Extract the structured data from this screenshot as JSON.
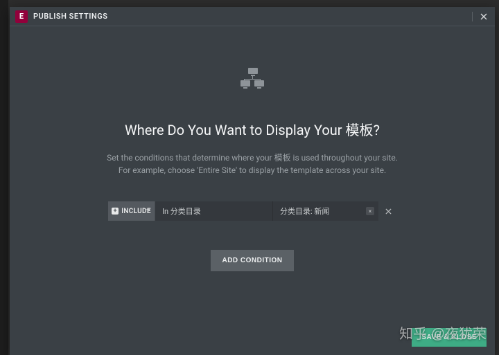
{
  "header": {
    "brand_glyph": "E",
    "title": "PUBLISH SETTINGS"
  },
  "hero": {
    "headline": "Where Do You Want to Display Your 模板?",
    "sub_line1": "Set the conditions that determine where your 模板 is used throughout your site.",
    "sub_line2": "For example, choose 'Entire Site' to display the template across your site."
  },
  "condition": {
    "mode_label": "INCLUDE",
    "mode_glyph": "+",
    "scope": "In 分类目录",
    "value": "分类目录: 新闻",
    "clear_glyph": "×"
  },
  "buttons": {
    "add_condition": "ADD CONDITION",
    "save_close": "SAVE & CLOSE"
  },
  "watermark": "知乎 @夜犹荣"
}
